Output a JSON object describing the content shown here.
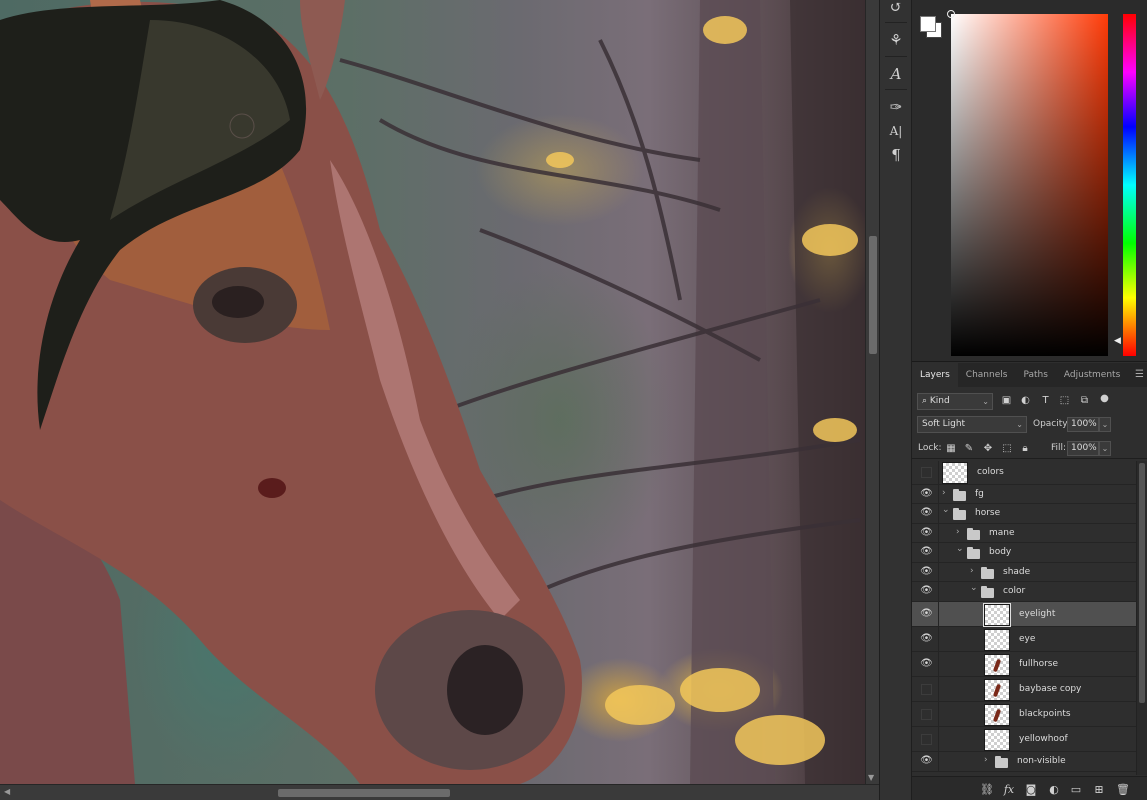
{
  "tools": [
    {
      "icon": "history-brush-icon",
      "glyph": "↺"
    },
    {
      "icon": "clone-source-icon",
      "glyph": "⚘"
    },
    {
      "icon": "character-style-icon",
      "glyph": "A"
    },
    {
      "icon": "tool-presets-icon",
      "glyph": "✑"
    },
    {
      "icon": "character-panel-icon",
      "glyph": "A|"
    },
    {
      "icon": "paragraph-panel-icon",
      "glyph": "¶"
    }
  ],
  "colors": {
    "foreground": "#ffffff",
    "background": "#ffffff",
    "hue_base": "#ff3b08"
  },
  "panel_tabs": [
    {
      "label": "Layers",
      "active": true
    },
    {
      "label": "Channels",
      "active": false
    },
    {
      "label": "Paths",
      "active": false
    },
    {
      "label": "Adjustments",
      "active": false
    }
  ],
  "filter": {
    "kind_label": "Kind"
  },
  "blend": {
    "mode": "Soft Light",
    "opacity_label": "Opacity:",
    "opacity_value": "100%",
    "fill_label": "Fill:",
    "fill_value": "100%",
    "lock_label": "Lock:"
  },
  "layers": [
    {
      "name": "colors",
      "type": "layer",
      "visible": false,
      "indent": 0,
      "thumb": "checker"
    },
    {
      "name": "fg",
      "type": "group",
      "visible": true,
      "indent": 0,
      "expanded": false
    },
    {
      "name": "horse",
      "type": "group",
      "visible": true,
      "indent": 0,
      "expanded": true
    },
    {
      "name": "mane",
      "type": "group",
      "visible": true,
      "indent": 1,
      "expanded": false
    },
    {
      "name": "body",
      "type": "group",
      "visible": true,
      "indent": 1,
      "expanded": true
    },
    {
      "name": "shade",
      "type": "group",
      "visible": true,
      "indent": 2,
      "expanded": false
    },
    {
      "name": "color",
      "type": "group",
      "visible": true,
      "indent": 2,
      "expanded": true
    },
    {
      "name": "eyelight",
      "type": "layer",
      "visible": true,
      "indent": 3,
      "selected": true,
      "thumb": "checker"
    },
    {
      "name": "eye",
      "type": "layer",
      "visible": true,
      "indent": 3,
      "thumb": "checker"
    },
    {
      "name": "fullhorse",
      "type": "layer",
      "visible": true,
      "indent": 3,
      "thumb": "mark"
    },
    {
      "name": "baybase copy",
      "type": "layer",
      "visible": false,
      "indent": 3,
      "thumb": "mark"
    },
    {
      "name": "blackpoints",
      "type": "layer",
      "visible": false,
      "indent": 3,
      "thumb": "mark"
    },
    {
      "name": "yellowhoof",
      "type": "layer",
      "visible": false,
      "indent": 3,
      "thumb": "checker"
    },
    {
      "name": "non-visible",
      "type": "group",
      "visible": true,
      "indent": 3,
      "expanded": false
    }
  ],
  "footer": {
    "fx_label": "fx"
  }
}
